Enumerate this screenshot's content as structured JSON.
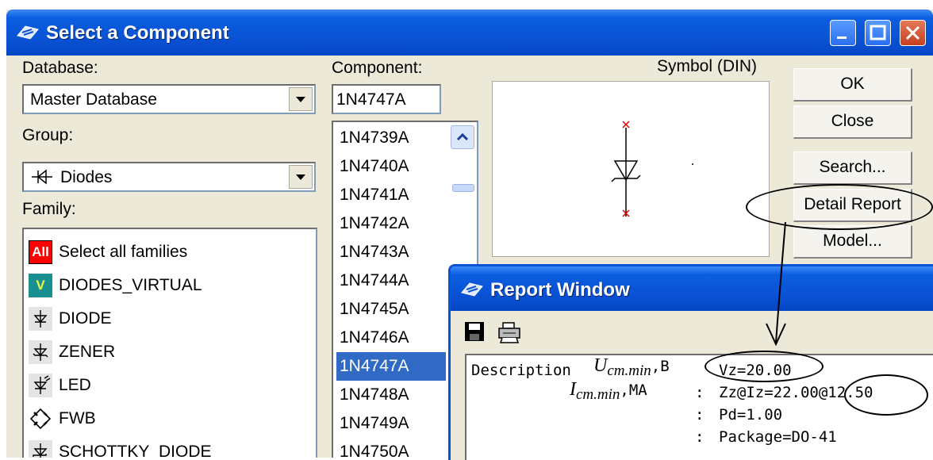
{
  "window": {
    "title": "Select a Component"
  },
  "database": {
    "label": "Database:",
    "value": "Master Database"
  },
  "group": {
    "label": "Group:",
    "value": "Diodes"
  },
  "family": {
    "label": "Family:",
    "items": [
      {
        "icon": "All",
        "label": "Select all families"
      },
      {
        "icon": "V",
        "label": "DIODES_VIRTUAL"
      },
      {
        "icon": "diode",
        "label": "DIODE"
      },
      {
        "icon": "zener",
        "label": "ZENER"
      },
      {
        "icon": "led",
        "label": "LED"
      },
      {
        "icon": "fwb",
        "label": "FWB"
      },
      {
        "icon": "schottky",
        "label": "SCHOTTKY_DIODE"
      }
    ]
  },
  "component": {
    "label": "Component:",
    "value": "1N4747A",
    "items": [
      "1N4739A",
      "1N4740A",
      "1N4741A",
      "1N4742A",
      "1N4743A",
      "1N4744A",
      "1N4745A",
      "1N4746A",
      "1N4747A",
      "1N4748A",
      "1N4749A",
      "1N4750A"
    ],
    "selected": "1N4747A"
  },
  "symbol": {
    "label": "Symbol (DIN)"
  },
  "buttons": {
    "ok": "OK",
    "close": "Close",
    "search": "Search...",
    "detail_report": "Detail Report",
    "model": "Model..."
  },
  "report": {
    "title": "Report Window",
    "lines": [
      {
        "key": "Description",
        "value": "Vz=20.00"
      },
      {
        "key": ":",
        "value": "Zz@Iz=22.00@12.50"
      },
      {
        "key": ":",
        "value": "Pd=1.00"
      },
      {
        "key": ":",
        "value": "Package=DO-41"
      }
    ],
    "annotations": {
      "u_main": "U",
      "u_sub": "cm.min",
      "u_unit": ",B",
      "i_main": "I",
      "i_sub": "cm.min",
      "i_unit": ",MA"
    }
  },
  "colors": {
    "titlebar": "#0a53d5",
    "selection": "#316ac5",
    "all_icon_bg": "#ff0000",
    "virtual_icon_bg": "#1a8f8f",
    "symbol_pins": "#e00000"
  }
}
